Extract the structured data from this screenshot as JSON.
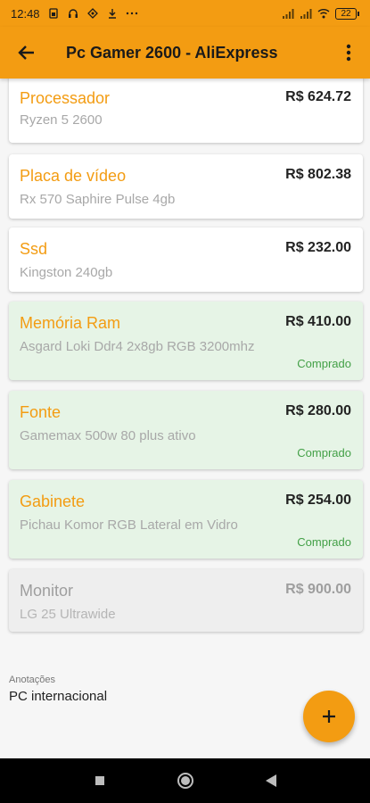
{
  "status_bar": {
    "time": "12:48",
    "left_icons": [
      "sim-icon",
      "headset-icon",
      "location-icon",
      "download-icon",
      "more-dots-icon"
    ],
    "battery": "22"
  },
  "app_bar": {
    "title": "Pc Gamer 2600 - AliExpress"
  },
  "items": [
    {
      "name": "Processador",
      "price": "R$ 624.72",
      "description": "Ryzen 5 2600",
      "status": ""
    },
    {
      "name": "Placa de vídeo",
      "price": "R$ 802.38",
      "description": "Rx 570 Saphire Pulse 4gb",
      "status": ""
    },
    {
      "name": "Ssd",
      "price": "R$ 232.00",
      "description": "Kingston 240gb",
      "status": ""
    },
    {
      "name": "Memória Ram",
      "price": "R$ 410.00",
      "description": "Asgard Loki Ddr4 2x8gb RGB 3200mhz",
      "status": "Comprado"
    },
    {
      "name": "Fonte",
      "price": "R$ 280.00",
      "description": "Gamemax 500w 80 plus ativo",
      "status": "Comprado"
    },
    {
      "name": "Gabinete",
      "price": "R$ 254.00",
      "description": "Pichau Komor RGB Lateral em Vidro",
      "status": "Comprado"
    },
    {
      "name": "Monitor",
      "price": "R$ 900.00",
      "description": "LG 25 Ultrawide",
      "status": ""
    }
  ],
  "notes": {
    "label": "Anotações",
    "value": "PC internacional"
  },
  "colors": {
    "accent": "#f39c12",
    "bought_bg": "#e6f4e6",
    "bought_text": "#43a047",
    "disabled_bg": "#eeeeee"
  }
}
